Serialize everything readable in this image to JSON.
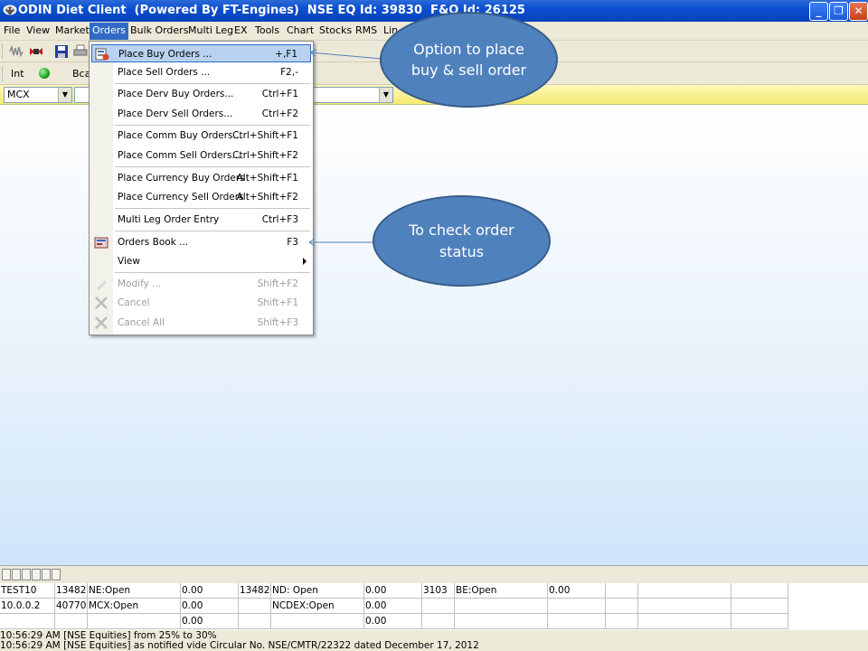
{
  "window": {
    "title": "ODIN Diet Client  (Powered By FT-Engines)  NSE EQ Id: 39830  F&O Id: 26125",
    "min_glyph": "_",
    "max_glyph": "❐",
    "close_glyph": "✕"
  },
  "menubar": {
    "items": [
      "File",
      "View",
      "Market",
      "Orders",
      "Bulk Orders",
      "Multi Leg",
      "EX",
      "Tools",
      "Chart",
      "Stocks",
      "RMS",
      "Lin"
    ],
    "active": "Orders"
  },
  "toolbar2": {
    "int_label": "Int",
    "bca_label": "Bca"
  },
  "filterbar": {
    "exchange_value": "MCX",
    "combo_arrow": "▼"
  },
  "orders_menu": {
    "items": [
      {
        "label": "Place Buy Orders ...",
        "shortcut": "+,F1",
        "icon": "buy-order-icon",
        "highlighted": true
      },
      {
        "label": "Place Sell Orders ...",
        "shortcut": "F2,-"
      },
      {
        "label": "Place Derv Buy Orders...",
        "shortcut": "Ctrl+F1"
      },
      {
        "label": "Place Derv Sell Orders...",
        "shortcut": "Ctrl+F2"
      },
      {
        "label": "Place Comm Buy Orders...",
        "shortcut": "Ctrl+Shift+F1"
      },
      {
        "label": "Place Comm Sell Orders...",
        "shortcut": "Ctrl+Shift+F2"
      },
      {
        "label": "Place Currency Buy Orders",
        "shortcut": "Alt+Shift+F1"
      },
      {
        "label": "Place Currency Sell Orders",
        "shortcut": "Alt+Shift+F2"
      },
      {
        "label": "Multi Leg Order Entry",
        "shortcut": "Ctrl+F3"
      },
      {
        "label": "Orders Book ...",
        "shortcut": "F3",
        "icon": "orders-book-icon"
      },
      {
        "label": "View",
        "shortcut": ""
      },
      {
        "label": "Modify ...",
        "shortcut": "Shift+F2",
        "disabled": true
      },
      {
        "label": "Cancel",
        "shortcut": "Shift+F1",
        "disabled": true
      },
      {
        "label": "Cancel All",
        "shortcut": "Shift+F3",
        "disabled": true
      }
    ]
  },
  "callouts": {
    "buy_sell": "Option to place buy & sell order",
    "order_status": "To check order status"
  },
  "status_grid": {
    "rows": [
      [
        "TEST10",
        "13482",
        "NE:Open",
        "0.00",
        "13482",
        "ND: Open",
        "0.00",
        "3103",
        "BE:Open",
        "0.00",
        "",
        "",
        ""
      ],
      [
        "10.0.0.2",
        "40770",
        "MCX:Open",
        "0.00",
        "",
        "NCDEX:Open",
        "0.00",
        "",
        "",
        "",
        "",
        "",
        ""
      ],
      [
        "",
        "",
        "",
        "0.00",
        "",
        "",
        "0.00",
        "",
        "",
        "",
        "",
        "",
        ""
      ]
    ]
  },
  "messages": [
    "10:56:29 AM [NSE Equities] from 25% to 30%",
    "10:56:29 AM [NSE Equities] as notified vide Circular No. NSE/CMTR/22322 dated December 17, 2012"
  ]
}
